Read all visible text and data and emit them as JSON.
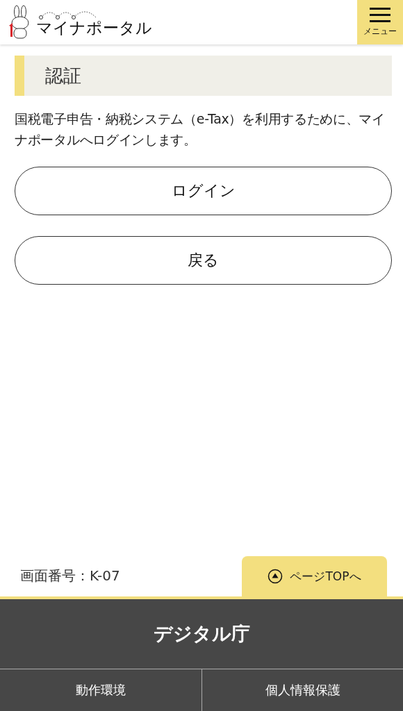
{
  "header": {
    "logo_text": "マイナポータル",
    "menu_label": "メニュー"
  },
  "section": {
    "heading": "認証",
    "description": "国税電子申告・納税システム（e-Tax）を利用するために、マイナポータルへログインします。"
  },
  "buttons": [
    "ログイン",
    "戻る"
  ],
  "screen_id": "画面番号：K-07",
  "page_top": "ページTOPへ",
  "footer": {
    "title": "デジタル庁",
    "links": [
      "動作環境",
      "個人情報保護"
    ]
  }
}
